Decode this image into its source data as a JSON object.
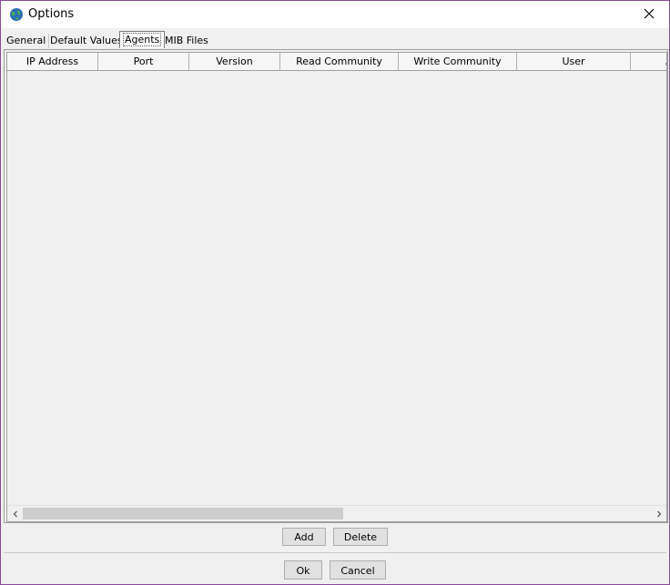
{
  "window": {
    "title": "Options"
  },
  "tabs": [
    {
      "label": "General"
    },
    {
      "label": "Default Values"
    },
    {
      "label": "Agents",
      "active": true
    },
    {
      "label": "MIB Files"
    }
  ],
  "table": {
    "columns": [
      "IP Address",
      "Port",
      "Version",
      "Read Community",
      "Write Community",
      "User",
      "A"
    ],
    "rows": []
  },
  "panel_buttons": {
    "add": "Add",
    "delete": "Delete"
  },
  "dialog_buttons": {
    "ok": "Ok",
    "cancel": "Cancel"
  },
  "icons": {
    "app": "globe-icon",
    "close": "close-icon",
    "scroll_left": "arrow-left-icon",
    "scroll_right": "arrow-right-icon"
  },
  "colors": {
    "window_border": "#8a4a9a",
    "background": "#f0f0f0",
    "title_bar": "#ffffff"
  }
}
